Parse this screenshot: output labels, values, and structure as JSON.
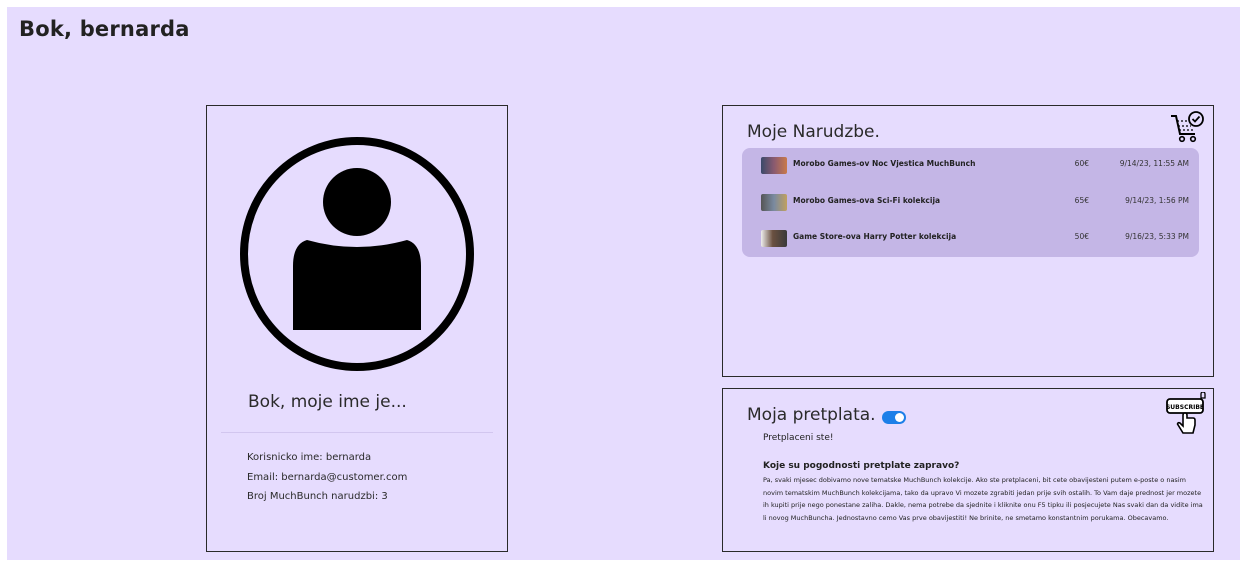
{
  "header": {
    "greeting": "Bok, bernarda"
  },
  "profile": {
    "avatar_icon": "user-avatar-icon",
    "title": "Bok, moje ime je...",
    "username": "Korisnicko ime: bernarda",
    "email": "Email: bernarda@customer.com",
    "order_count": "Broj MuchBunch narudzbi: 3"
  },
  "orders": {
    "title": "Moje Narudzbe.",
    "icon": "cart-check-icon",
    "items": [
      {
        "name": "Morobo Games-ov Noc Vjestica MuchBunch",
        "price": "60€",
        "date": "9/14/23, 11:55 AM"
      },
      {
        "name": "Morobo Games-ova Sci-Fi kolekcija",
        "price": "65€",
        "date": "9/14/23, 1:56 PM"
      },
      {
        "name": "Game Store-ova Harry Potter kolekcija",
        "price": "50€",
        "date": "9/16/23, 5:33 PM"
      }
    ]
  },
  "subscription": {
    "title": "Moja pretplata.",
    "toggle_on": true,
    "icon": "subscribe-hand-icon",
    "icon_label": "SUBSCRIBE",
    "status": "Pretplaceni ste!",
    "question": "Koje su pogodnosti pretplate zapravo?",
    "text": "Pa, svaki mjesec dobivamo nove tematske MuchBunch kolekcije. Ako ste pretplaceni, bit cete obavijesteni putem e-poste o nasim novim tematskim MuchBunch kolekcijama, tako da upravo Vi mozete zgrabiti jedan prije svih ostalih. To Vam daje prednost jer mozete ih kupiti prije nego ponestane zaliha. Dakle, nema potrebe da sjednite i kliknite onu F5 tipku ili posjecujete Nas svaki dan da vidite ima li novog MuchBuncha. Jednostavno cemo Vas prve obavijestiti! Ne brinite, ne smetamo konstantnim porukama. Obecavamo."
  },
  "colors": {
    "background": "#e6dcfe",
    "orders_list": "#c4b6e6",
    "toggle": "#1d7fe8"
  }
}
